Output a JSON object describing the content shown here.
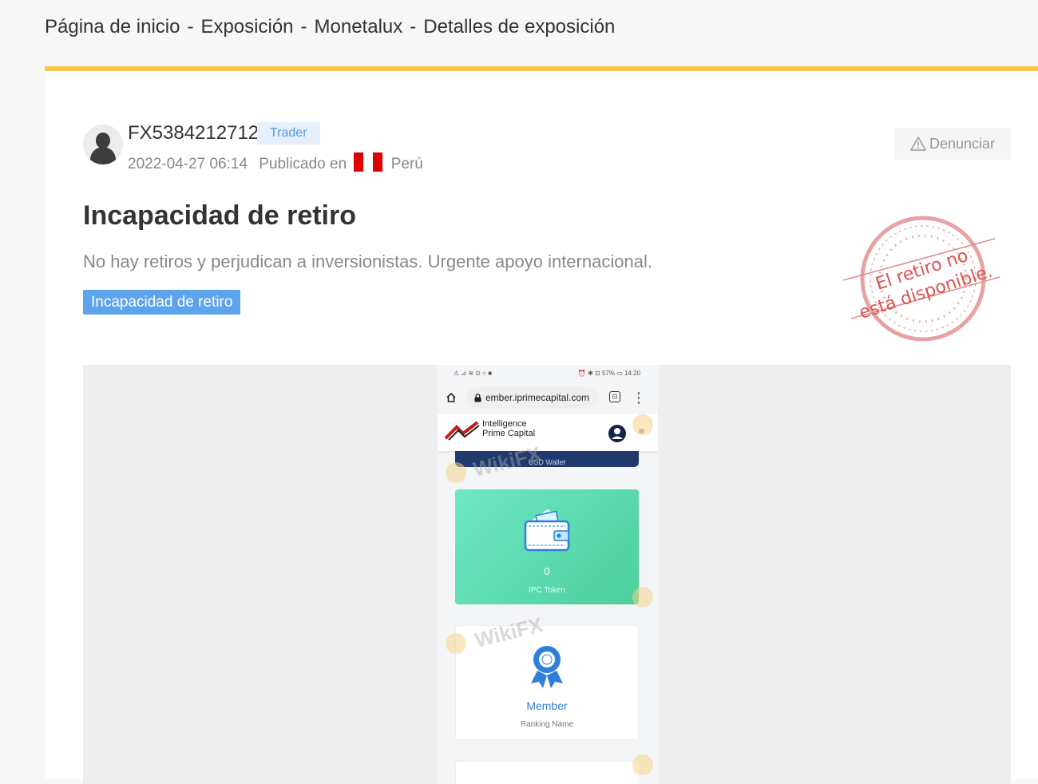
{
  "breadcrumb": {
    "items": [
      "Página de inicio",
      "Exposición",
      "Monetalux",
      "Detalles de exposición"
    ],
    "separator": "-"
  },
  "post": {
    "user_id": "FX5384212712",
    "role": "Trader",
    "datetime": "2022-04-27 06:14",
    "published_in": "Publicado en",
    "country": "Perú",
    "report_label": "Denunciar",
    "title": "Incapacidad de retiro",
    "description": "No hay retiros y perjudican a inversionistas. Urgente apoyo internacional.",
    "tag": "Incapacidad de retiro",
    "stamp_line1": "El retiro no",
    "stamp_line2": "está disponible."
  },
  "screenshot": {
    "status_left": "⚠ ⊿ ≋ ⊙ ○ ■",
    "status_right": "⏰ ✱ ⊡ 57% ▭ 14:20",
    "url": "ember.iprimecapital.com",
    "logo_line1": "Intelligence",
    "logo_line2": "Prime Capital",
    "wallet_strip_label": "USD Wallet",
    "token_value": "0",
    "token_label": "IPC Token",
    "member_value": "Member",
    "member_label": "Ranking Name",
    "watermark": "WikiFX"
  },
  "colors": {
    "accent_bar": "#fbc554",
    "tag_bg": "#5da4ec",
    "badge_text": "#5b9ae4",
    "stamp_red": "#d9534f",
    "peru_red": "#e00000"
  },
  "icons": {
    "report": "warning-icon",
    "avatar": "user-avatar-icon",
    "flag": "peru-flag-icon"
  }
}
